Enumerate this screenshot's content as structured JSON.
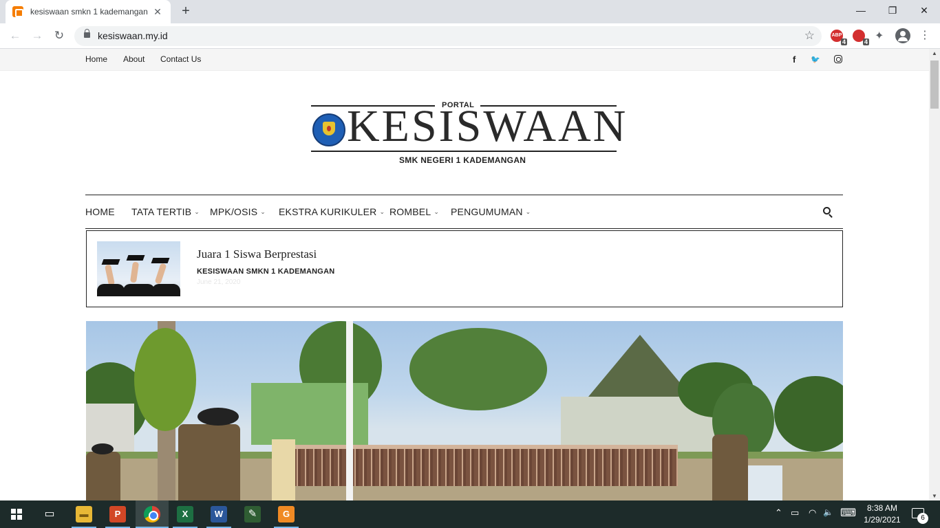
{
  "browser": {
    "tab_title": "kesiswaan smkn 1 kademangan",
    "tab_close": "✕",
    "new_tab": "+",
    "url": "kesiswaan.my.id",
    "back": "←",
    "forward": "→",
    "reload": "↻",
    "star": "☆",
    "window_minimize": "—",
    "window_restore": "❐",
    "window_close": "✕",
    "extensions": [
      {
        "name": "adblock-extension-icon",
        "label": "ABP",
        "badge": "4"
      },
      {
        "name": "ublock-extension-icon",
        "label": "",
        "badge": "4"
      }
    ],
    "puzzle": "✦",
    "menu": "⋮"
  },
  "site": {
    "top_links": [
      "Home",
      "About",
      "Contact Us"
    ],
    "social": {
      "facebook": "f",
      "twitter": "🐦"
    },
    "logo": {
      "portal": "PORTAL",
      "word": "KESISWAAN",
      "subtitle": "SMK NEGERI 1 KADEMANGAN"
    },
    "nav": [
      {
        "label": "HOME",
        "dropdown": false
      },
      {
        "label": "TATA TERTIB",
        "dropdown": true
      },
      {
        "label": "MPK/OSIS",
        "dropdown": true
      },
      {
        "label": "EKSTRA KURIKULER",
        "dropdown": true
      },
      {
        "label": "ROMBEL",
        "dropdown": true
      },
      {
        "label": "PENGUMUMAN",
        "dropdown": true
      }
    ],
    "chevron": "⌄",
    "featured_post": {
      "title": "Juara 1 Siswa Berprestasi",
      "author": "KESISWAAN SMKN 1 KADEMANGAN",
      "date": "June 21, 2020"
    }
  },
  "taskbar": {
    "apps": [
      {
        "name": "task-view-icon",
        "glyph": "▭"
      },
      {
        "name": "file-explorer-icon",
        "glyph": "▬"
      },
      {
        "name": "powerpoint-icon",
        "glyph": "P"
      },
      {
        "name": "chrome-icon",
        "glyph": ""
      },
      {
        "name": "excel-icon",
        "glyph": "X"
      },
      {
        "name": "word-icon",
        "glyph": "W"
      },
      {
        "name": "paint-tool-icon",
        "glyph": "✎"
      },
      {
        "name": "orange-app-icon",
        "glyph": "G"
      }
    ],
    "tray": {
      "chevron": "⌃",
      "battery": "▭",
      "wifi": "◠",
      "volume": "🔈",
      "keyboard": "⌨"
    },
    "time": "8:38 AM",
    "date": "1/29/2021",
    "notifications": "6"
  },
  "colors": {
    "page_text": "#222222",
    "tab_strip": "#dee1e6",
    "taskbar": "#1d2b2a",
    "powerpoint": "#d24726",
    "excel": "#1d6f42",
    "word": "#2b579a",
    "orange_app": "#f08a24"
  }
}
